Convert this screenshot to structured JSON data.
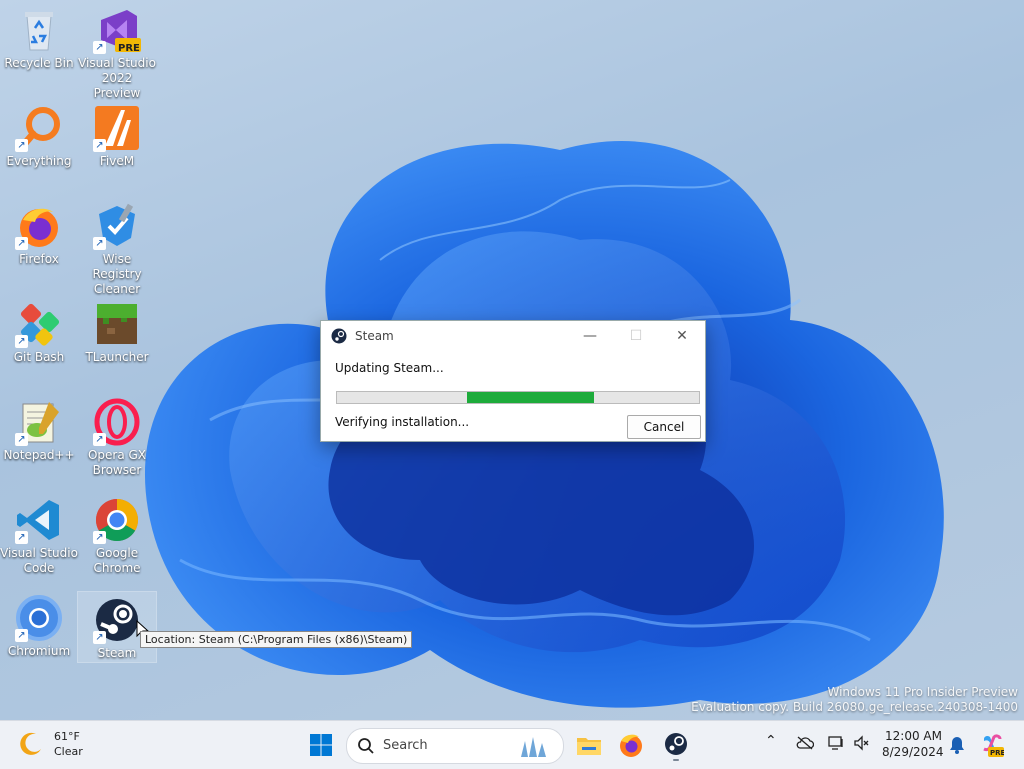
{
  "desktop": {
    "icons": [
      {
        "label": "Recycle Bin",
        "icon": "recycle-bin-icon"
      },
      {
        "label": "Visual Studio 2022 Preview",
        "icon": "visual-studio-preview-icon",
        "badge": "PRE"
      },
      {
        "label": "Everything",
        "icon": "everything-search-icon"
      },
      {
        "label": "FiveM",
        "icon": "fivem-icon"
      },
      {
        "label": "Firefox",
        "icon": "firefox-icon"
      },
      {
        "label": "Wise Registry Cleaner",
        "icon": "wise-registry-cleaner-icon"
      },
      {
        "label": "Git Bash",
        "icon": "git-bash-icon"
      },
      {
        "label": "TLauncher",
        "icon": "tlauncher-icon"
      },
      {
        "label": "Notepad++",
        "icon": "notepad-plus-plus-icon"
      },
      {
        "label": "Opera GX Browser",
        "icon": "opera-gx-icon"
      },
      {
        "label": "Visual Studio Code",
        "icon": "vscode-icon"
      },
      {
        "label": "Google Chrome",
        "icon": "chrome-icon"
      },
      {
        "label": "Chromium",
        "icon": "chromium-icon"
      },
      {
        "label": "Steam",
        "icon": "steam-icon"
      }
    ],
    "tooltip": "Location: Steam (C:\\Program Files (x86)\\Steam)"
  },
  "dialog": {
    "title": "Steam",
    "status": "Updating Steam...",
    "progress_start": 0.36,
    "progress_end": 0.71,
    "detail": "Verifying installation...",
    "cancel_label": "Cancel",
    "minimize_glyph": "—",
    "maximize_glyph": "☐",
    "close_glyph": "✕"
  },
  "watermark": {
    "line1": "Windows 11 Pro Insider Preview",
    "line2": "Evaluation copy. Build 26080.ge_release.240308-1400"
  },
  "taskbar": {
    "weather_temp": "61°F",
    "weather_desc": "Clear",
    "search_label": "Search",
    "time": "12:00 AM",
    "date": "8/29/2024",
    "colors": {
      "accent": "#0067c0",
      "progress": "#1dab3b"
    }
  }
}
